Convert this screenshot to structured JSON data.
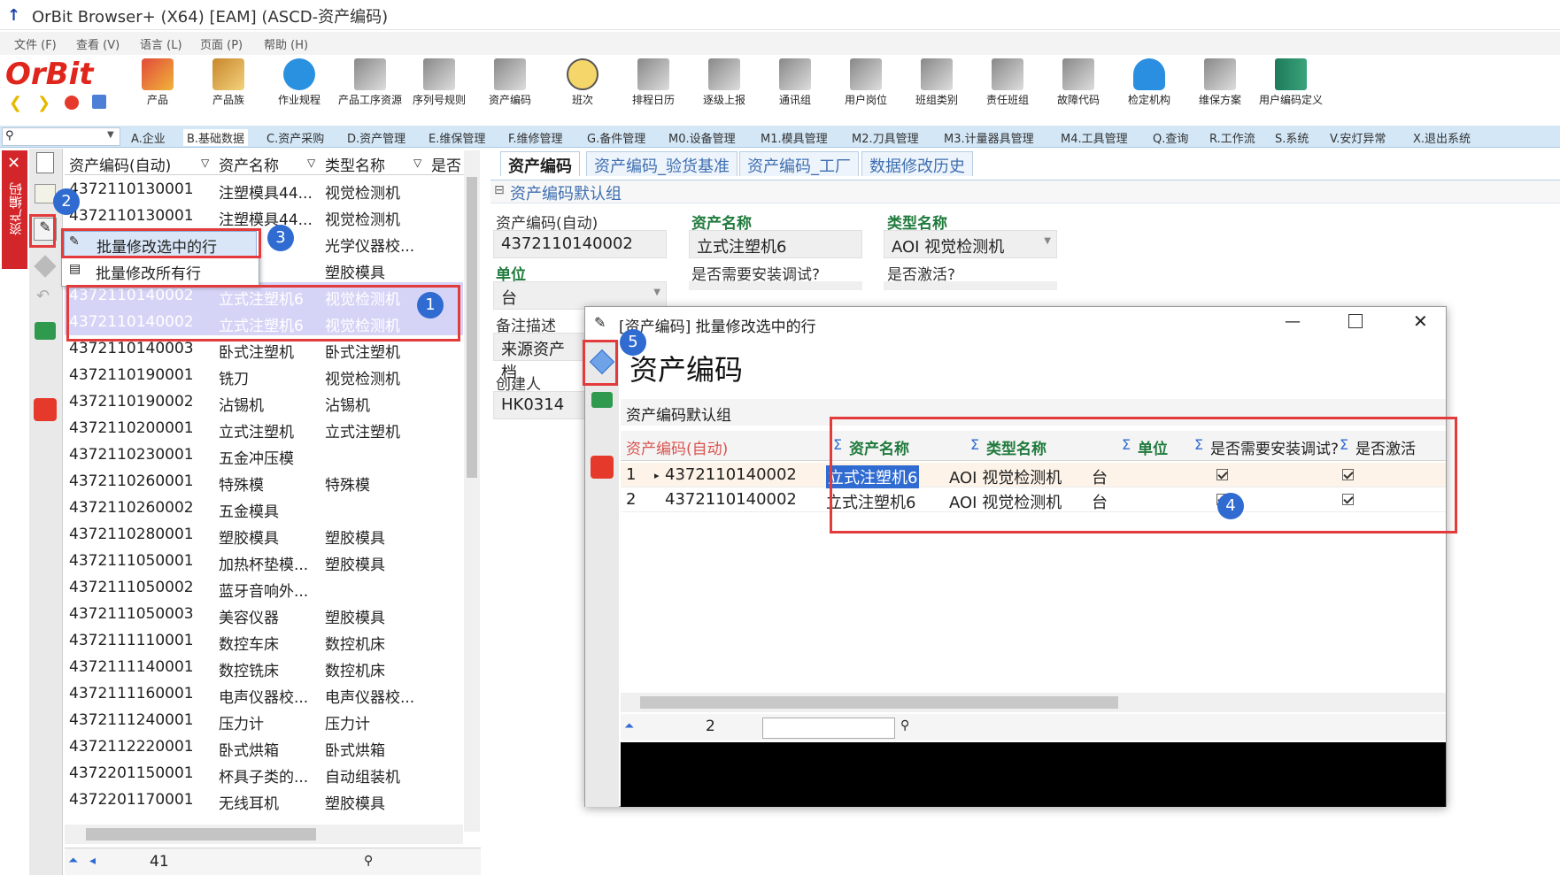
{
  "app": {
    "title": "OrBit Browser+ (X64) [EAM] (ASCD-资产编码)"
  },
  "menu": [
    "文件 (F)",
    "查看 (V)",
    "语言 (L)",
    "页面 (P)",
    "帮助 (H)"
  ],
  "logo": "OrBit",
  "toolbar": [
    "产品",
    "产品族",
    "作业规程",
    "产品工序资源",
    "序列号规则",
    "资产编码",
    "班次",
    "排程日历",
    "逐级上报",
    "通讯组",
    "用户岗位",
    "班组类别",
    "责任班组",
    "故障代码",
    "检定机构",
    "维保方案",
    "用户编码定义"
  ],
  "modules": [
    "A.企业",
    "B.基础数据",
    "C.资产采购",
    "D.资产管理",
    "E.维保管理",
    "F.维修管理",
    "G.备件管理",
    "M0.设备管理",
    "M1.模具管理",
    "M2.刀具管理",
    "M3.计量器具管理",
    "M4.工具管理",
    "Q.查询",
    "R.工作流",
    "S.系统",
    "V.安灯异常",
    "X.退出系统"
  ],
  "left_tab": "资产编码",
  "grid": {
    "headers": [
      "资产编码(自动)",
      "资产名称",
      "类型名称",
      "是否"
    ],
    "rows": [
      [
        "4372110130001",
        "注塑模具44...",
        "视觉检测机"
      ],
      [
        "4372110130001",
        "注塑模具44...",
        "视觉检测机"
      ],
      [
        "",
        "...",
        "光学仪器校..."
      ],
      [
        "",
        "塑机5",
        "塑胶模具"
      ],
      [
        "4372110140002",
        "立式注塑机6",
        "视觉检测机"
      ],
      [
        "4372110140002",
        "立式注塑机6",
        "视觉检测机"
      ],
      [
        "4372110140003",
        "卧式注塑机",
        "卧式注塑机"
      ],
      [
        "4372110190001",
        "铣刀",
        "视觉检测机"
      ],
      [
        "4372110190002",
        "沾锡机",
        "沾锡机"
      ],
      [
        "4372110200001",
        "立式注塑机",
        "立式注塑机"
      ],
      [
        "4372110230001",
        "五金冲压模",
        ""
      ],
      [
        "4372110260001",
        "特殊模",
        "特殊模"
      ],
      [
        "4372110260002",
        "五金模具",
        ""
      ],
      [
        "4372110280001",
        "塑胶模具",
        "塑胶模具"
      ],
      [
        "4372111050001",
        "加热杯垫模...",
        "塑胶模具"
      ],
      [
        "4372111050002",
        "蓝牙音响外...",
        ""
      ],
      [
        "4372111050003",
        "美容仪器",
        "塑胶模具"
      ],
      [
        "4372111110001",
        "数控车床",
        "数控机床"
      ],
      [
        "4372111140001",
        "数控铣床",
        "数控机床"
      ],
      [
        "4372111160001",
        "电声仪器校...",
        "电声仪器校..."
      ],
      [
        "4372111240001",
        "压力计",
        "压力计"
      ],
      [
        "4372112220001",
        "卧式烘箱",
        "卧式烘箱"
      ],
      [
        "4372201150001",
        "杯具子类的...",
        "自动组装机"
      ],
      [
        "4372201170001",
        "无线耳机",
        "塑胶模具"
      ]
    ],
    "count": "41"
  },
  "context_menu": [
    "批量修改选中的行",
    "批量修改所有行"
  ],
  "tabs": [
    "资产编码",
    "资产编码_验货基准",
    "资产编码_工厂",
    "数据修改历史"
  ],
  "group_title": "资产编码默认组",
  "form": {
    "code_label": "资产编码(自动)",
    "code_value": "4372110140002",
    "name_label": "资产名称",
    "name_value": "立式注塑机6",
    "type_label": "类型名称",
    "type_value": "AOI 视觉检测机",
    "unit_label": "单位",
    "unit_value": "台",
    "install_label": "是否需要安装调试?",
    "active_label": "是否激活?",
    "remark_label": "备注描述",
    "remark_value": "来源资产档",
    "creator_label": "创建人",
    "creator_value": "HK0314"
  },
  "dialog": {
    "title": "[资产编码] 批量修改选中的行",
    "heading": "资产编码",
    "group": "资产编码默认组",
    "headers": [
      "资产编码(自动)",
      "资产名称",
      "类型名称",
      "单位",
      "是否需要安装调试?",
      "是否激活"
    ],
    "rows": [
      [
        "1",
        "4372110140002",
        "立式注塑机6",
        "AOI 视觉检测机",
        "台"
      ],
      [
        "2",
        "4372110140002",
        "立式注塑机6",
        "AOI 视觉检测机",
        "台"
      ]
    ],
    "page": "2"
  },
  "badges": [
    "1",
    "2",
    "3",
    "4",
    "5"
  ]
}
